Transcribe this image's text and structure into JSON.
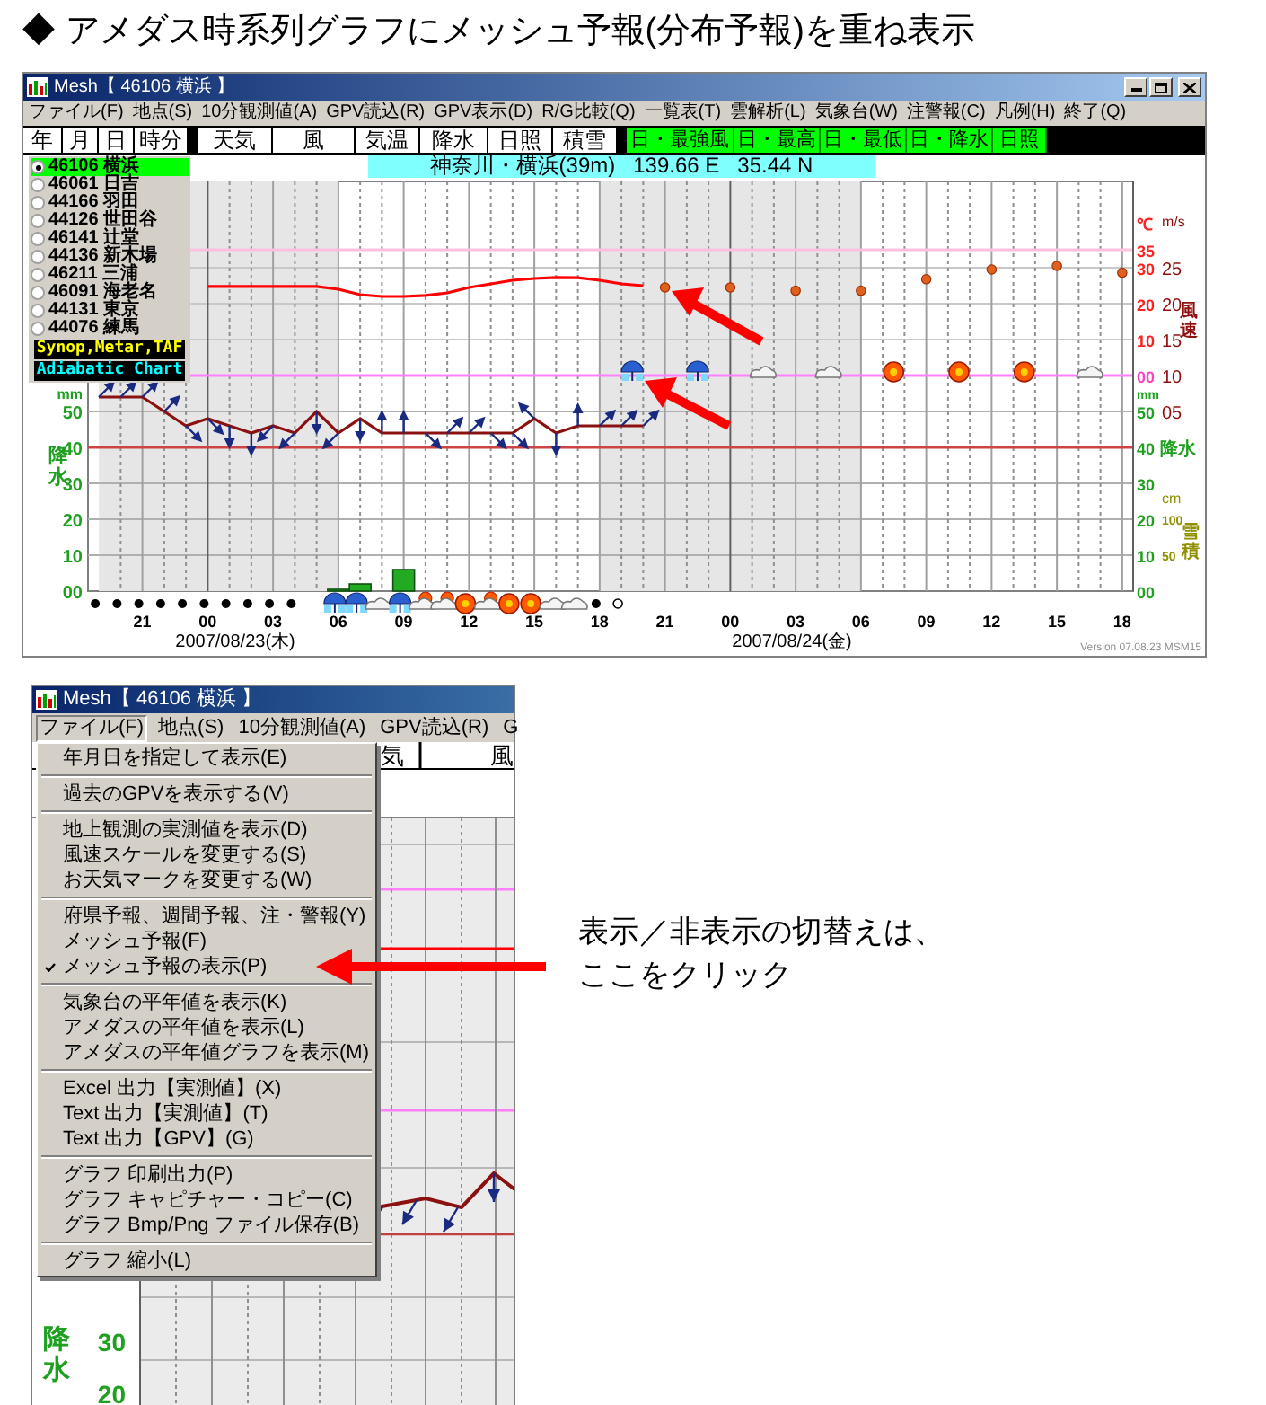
{
  "heading": "◆ アメダス時系列グラフにメッシュ予報(分布予報)を重ね表示",
  "main_window": {
    "title": "Mesh【 46106 横浜 】",
    "menu": [
      "ファイル(F)",
      "地点(S)",
      "10分観測値(A)",
      "GPV読込(R)",
      "GPV表示(D)",
      "R/G比較(Q)",
      "一覧表(T)",
      "雲解析(L)",
      "気象台(W)",
      "注警報(C)",
      "凡例(H)",
      "終了(Q)"
    ],
    "tabs": [
      {
        "label": "年",
        "kind": "date"
      },
      {
        "label": "月",
        "kind": "date"
      },
      {
        "label": "日",
        "kind": "date"
      },
      {
        "label": "時分",
        "kind": "date"
      },
      {
        "label": "天気",
        "kind": "element"
      },
      {
        "label": "風",
        "kind": "element"
      },
      {
        "label": "気温",
        "kind": "element"
      },
      {
        "label": "降水",
        "kind": "element"
      },
      {
        "label": "日照",
        "kind": "element"
      },
      {
        "label": "積雪",
        "kind": "element"
      },
      {
        "label": "日・最強風",
        "kind": "daily"
      },
      {
        "label": "日・最高",
        "kind": "daily"
      },
      {
        "label": "日・最低",
        "kind": "daily"
      },
      {
        "label": "日・降水",
        "kind": "daily"
      },
      {
        "label": "日照",
        "kind": "daily"
      }
    ],
    "stations": [
      {
        "label": "46106 横浜",
        "selected": true
      },
      {
        "label": "46061 日吉",
        "selected": false
      },
      {
        "label": "44166 羽田",
        "selected": false
      },
      {
        "label": "44126 世田谷",
        "selected": false
      },
      {
        "label": "46141 辻堂",
        "selected": false
      },
      {
        "label": "44136 新木場",
        "selected": false
      },
      {
        "label": "46211 三浦",
        "selected": false
      },
      {
        "label": "46091 海老名",
        "selected": false
      },
      {
        "label": "44131 東京",
        "selected": false
      },
      {
        "label": "44076 練馬",
        "selected": false
      }
    ],
    "chart_buttons": [
      {
        "label": "Synop,Metar,TAF",
        "kind": "synop"
      },
      {
        "label": "Adiabatic Chart",
        "kind": "adiabatic"
      }
    ],
    "location": {
      "place": "神奈川・横浜(39m)",
      "longitude": "139.66 E",
      "latitude": "35.44 N"
    },
    "graph": {
      "left_title": "降水",
      "chart_data": {
        "type": "line",
        "grid": true,
        "categories": [
          null,
          null,
          "21",
          null,
          null,
          "00",
          null,
          null,
          "03",
          null,
          null,
          "06",
          null,
          null,
          "09",
          null,
          null,
          "12",
          null,
          null,
          "15",
          null,
          null,
          "18",
          null,
          null,
          "21",
          null,
          null,
          "00",
          null,
          null,
          "03",
          null,
          null,
          "06",
          null,
          null,
          "09",
          null,
          null,
          "12",
          null,
          null,
          "15",
          null,
          null,
          "18"
        ],
        "ylim": [
          0,
          114
        ],
        "ref_lines": [
          {
            "axis": "y2",
            "value": 35,
            "color": "#ffc0e0"
          },
          {
            "axis": "y2",
            "value": 0,
            "color": "#ff80ff"
          },
          {
            "axis": "y3",
            "value": 0,
            "color": "#cc4444"
          }
        ],
        "yticks": [
          {
            "value": 0,
            "label": "00"
          },
          {
            "value": 10,
            "label": "10"
          },
          {
            "value": 20,
            "label": "20"
          },
          {
            "value": 30,
            "label": "30"
          },
          {
            "value": 40,
            "label": "40"
          },
          {
            "value": 50,
            "label": "50"
          }
        ],
        "y2lim": [
          -60,
          54
        ],
        "y2ticks": [
          {
            "value": 35,
            "label": "35"
          },
          {
            "value": 30,
            "label": "30"
          },
          {
            "value": 20,
            "label": "20"
          },
          {
            "value": 10,
            "label": "10"
          },
          {
            "value": 0,
            "label": "00"
          }
        ],
        "y3lim": [
          -20,
          37
        ],
        "y3ticks": [
          {
            "value": 25,
            "label": "25"
          },
          {
            "value": 20,
            "label": "20"
          },
          {
            "value": 15,
            "label": "15"
          },
          {
            "value": 10,
            "label": "10"
          },
          {
            "value": 5,
            "label": "05"
          }
        ],
        "series": [
          {
            "color": "#22aa22",
            "type": "bar",
            "values": [
              null,
              null,
              null,
              null,
              null,
              null,
              null,
              null,
              null,
              null,
              null,
              0.5,
              2,
              null,
              6,
              null,
              null,
              null,
              null,
              null,
              null,
              null,
              null,
              null,
              null,
              null,
              null,
              null,
              null,
              null,
              null,
              null,
              null,
              null,
              null,
              null,
              null,
              null,
              null,
              null,
              null,
              null,
              null,
              null,
              null,
              null,
              null,
              null
            ]
          },
          {
            "color": "#ff0000",
            "axis": "y2",
            "values": [
              null,
              null,
              null,
              null,
              null,
              24.8,
              24.8,
              24.8,
              24.8,
              24.8,
              24.8,
              24,
              22.5,
              22,
              22,
              22.3,
              23,
              24.5,
              25.5,
              26.5,
              27,
              27.3,
              27.2,
              26.5,
              25.5,
              25,
              null,
              null,
              null,
              null,
              null,
              null,
              null,
              null,
              null,
              null,
              null,
              null,
              null,
              null,
              null,
              null,
              null,
              null,
              null,
              null,
              null,
              null
            ]
          },
          {
            "color": "#e06020",
            "axis": "y2",
            "type": "scatter",
            "values": [
              null,
              null,
              null,
              null,
              null,
              null,
              null,
              null,
              null,
              null,
              null,
              null,
              null,
              null,
              null,
              null,
              null,
              null,
              null,
              null,
              null,
              null,
              null,
              null,
              null,
              null,
              24.5,
              null,
              null,
              24.5,
              null,
              null,
              23.6,
              null,
              null,
              23.6,
              null,
              null,
              26.8,
              null,
              null,
              29.5,
              null,
              null,
              30.5,
              null,
              null,
              28.6
            ]
          },
          {
            "color": "#8b1010",
            "axis": "y3",
            "values": [
              7,
              7,
              7,
              5,
              3,
              4,
              3,
              2,
              3,
              2,
              5,
              2,
              4,
              2,
              2,
              2,
              2,
              2,
              2,
              2,
              4,
              2,
              3,
              3,
              3,
              3,
              null,
              null,
              null,
              null,
              null,
              null,
              null,
              null,
              null,
              null,
              null,
              null,
              null,
              null,
              null,
              null,
              null,
              null,
              null,
              null,
              null,
              null
            ]
          }
        ]
      },
      "left_unit": "mm",
      "temperature_axis": {
        "unit": "℃"
      },
      "precipitation_right": {
        "unit": "mm",
        "ticks": [
          "50",
          "40",
          "30",
          "20",
          "10",
          "00"
        ],
        "title": "降水"
      },
      "wind_axis": {
        "unit": "m/s",
        "title": "風速"
      },
      "snow_axis": {
        "unit": "cm",
        "ticks": [
          "100",
          "50"
        ],
        "title": "雪積"
      },
      "wind_arrows": [
        {
          "kind": "ne"
        },
        {
          "kind": "ne"
        },
        {
          "kind": "ne"
        },
        {
          "kind": "ne"
        },
        {
          "kind": "se"
        },
        {
          "kind": "se"
        },
        {
          "kind": "s"
        },
        {
          "kind": "s"
        },
        {
          "kind": "sw"
        },
        {
          "kind": "sw"
        },
        {
          "kind": "s"
        },
        {
          "kind": "sw"
        },
        {
          "kind": "s"
        },
        {
          "kind": "n"
        },
        {
          "kind": "n"
        },
        {
          "kind": "se"
        },
        {
          "kind": "ne"
        },
        {
          "kind": "ne"
        },
        {
          "kind": "se"
        },
        {
          "kind": "se"
        },
        {
          "kind": "nw"
        },
        {
          "kind": "s"
        },
        {
          "kind": "n"
        },
        {
          "kind": "ne"
        },
        {
          "kind": "ne"
        },
        {
          "kind": "ne"
        }
      ],
      "weather_marks": [
        {
          "kind": "dot"
        },
        {
          "kind": "dot"
        },
        {
          "kind": "dot"
        },
        {
          "kind": "dot"
        },
        {
          "kind": "dot"
        },
        {
          "kind": "dot"
        },
        {
          "kind": "dot"
        },
        {
          "kind": "dot"
        },
        {
          "kind": "dot"
        },
        {
          "kind": "dot"
        },
        {
          "kind": "none"
        },
        {
          "kind": "rain"
        },
        {
          "kind": "rain"
        },
        {
          "kind": "cloud"
        },
        {
          "kind": "rain"
        },
        {
          "kind": "sun-cloud"
        },
        {
          "kind": "sun-cloud"
        },
        {
          "kind": "sun"
        },
        {
          "kind": "sun-cloud"
        },
        {
          "kind": "sun"
        },
        {
          "kind": "sun"
        },
        {
          "kind": "cloud"
        },
        {
          "kind": "cloud"
        },
        {
          "kind": "dot"
        },
        {
          "kind": "open"
        }
      ],
      "forecast_marks": [
        {
          "kind": "rain"
        },
        {
          "kind": "rain"
        },
        {
          "kind": "cloud"
        },
        {
          "kind": "cloud"
        },
        {
          "kind": "sun"
        },
        {
          "kind": "sun"
        },
        {
          "kind": "sun"
        },
        {
          "kind": "cloud"
        }
      ],
      "dates": [
        "2007/08/23(木)",
        "2007/08/24(金)"
      ]
    },
    "version": "Version 07.08.23 MSM15"
  },
  "menu_window": {
    "title": "Mesh【 46106 横浜 】",
    "menu": [
      {
        "label": "ファイル(F)",
        "selected": true
      },
      {
        "label": "地点(S)",
        "selected": false
      },
      {
        "label": "10分観測値(A)",
        "selected": false
      },
      {
        "label": "GPV読込(R)",
        "selected": false
      },
      {
        "label": "G",
        "selected": false
      }
    ],
    "background_tabs": [
      "気",
      "風"
    ],
    "background_axis": {
      "title": "降水",
      "ticks": [
        "30",
        "20"
      ]
    },
    "file_menu": [
      [
        {
          "label": "年月日を指定して表示(E)",
          "checked": false
        }
      ],
      [
        {
          "label": "過去のGPVを表示する(V)",
          "checked": false
        }
      ],
      [
        {
          "label": "地上観測の実測値を表示(D)",
          "checked": false
        },
        {
          "label": "風速スケールを変更する(S)",
          "checked": false
        },
        {
          "label": "お天気マークを変更する(W)",
          "checked": false
        }
      ],
      [
        {
          "label": "府県予報、週間予報、注・警報(Y)",
          "checked": false
        },
        {
          "label": "メッシュ予報(F)",
          "checked": false
        },
        {
          "label": "メッシュ予報の表示(P)",
          "checked": true
        }
      ],
      [
        {
          "label": "気象台の平年値を表示(K)",
          "checked": false
        },
        {
          "label": "アメダスの平年値を表示(L)",
          "checked": false
        },
        {
          "label": "アメダスの平年値グラフを表示(M)",
          "checked": false
        }
      ],
      [
        {
          "label": "Excel 出力【実測値】(X)",
          "checked": false
        },
        {
          "label": "Text 出力【実測値】(T)",
          "checked": false
        },
        {
          "label": "Text 出力【GPV】(G)",
          "checked": false
        }
      ],
      [
        {
          "label": "グラフ 印刷出力(P)",
          "checked": false
        },
        {
          "label": "グラフ キャピチャー・コピー(C)",
          "checked": false
        },
        {
          "label": "グラフ Bmp/Png ファイル保存(B)",
          "checked": false
        }
      ],
      [
        {
          "label": "グラフ 縮小(L)",
          "checked": false
        }
      ]
    ]
  },
  "callout": [
    "表示／非表示の切替えは、",
    "ここをクリック"
  ]
}
